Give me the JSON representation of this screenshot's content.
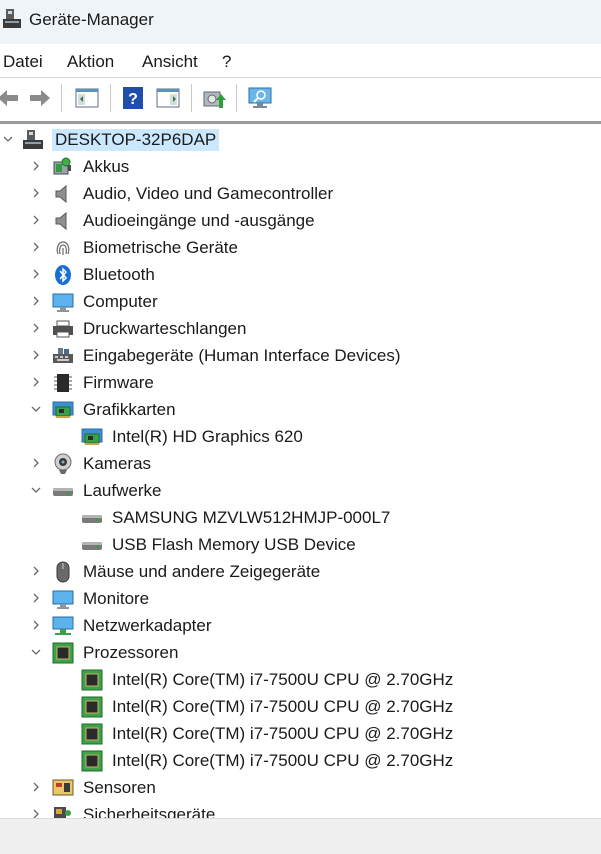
{
  "window": {
    "title": "Geräte-Manager"
  },
  "menu": [
    "Datei",
    "Aktion",
    "Ansicht",
    "?"
  ],
  "toolbar": [
    "back-icon",
    "forward-icon",
    "show-hide-console-tree-icon",
    "help-icon",
    "properties-pane-icon",
    "update-driver-icon",
    "scan-hardware-icon"
  ],
  "tree": {
    "root": "DESKTOP-32P6DAP",
    "nodes": [
      {
        "label": "Akkus",
        "icon": "battery-icon",
        "expanded": false,
        "children": []
      },
      {
        "label": "Audio, Video und Gamecontroller",
        "icon": "speaker-icon",
        "expanded": false,
        "children": []
      },
      {
        "label": "Audioeingänge und -ausgänge",
        "icon": "speaker-icon",
        "expanded": false,
        "children": []
      },
      {
        "label": "Biometrische Geräte",
        "icon": "fingerprint-icon",
        "expanded": false,
        "children": []
      },
      {
        "label": "Bluetooth",
        "icon": "bluetooth-icon",
        "expanded": false,
        "children": []
      },
      {
        "label": "Computer",
        "icon": "monitor-icon",
        "expanded": false,
        "children": []
      },
      {
        "label": "Druckwarteschlangen",
        "icon": "printer-icon",
        "expanded": false,
        "children": []
      },
      {
        "label": "Eingabegeräte (Human Interface Devices)",
        "icon": "hid-icon",
        "expanded": false,
        "children": []
      },
      {
        "label": "Firmware",
        "icon": "chip-icon",
        "expanded": false,
        "children": []
      },
      {
        "label": "Grafikkarten",
        "icon": "display-adapter-icon",
        "expanded": true,
        "children": [
          {
            "label": "Intel(R) HD Graphics 620",
            "icon": "display-adapter-icon"
          }
        ]
      },
      {
        "label": "Kameras",
        "icon": "webcam-icon",
        "expanded": false,
        "children": []
      },
      {
        "label": "Laufwerke",
        "icon": "drive-icon",
        "expanded": true,
        "children": [
          {
            "label": "SAMSUNG MZVLW512HMJP-000L7",
            "icon": "drive-icon"
          },
          {
            "label": "USB Flash Memory USB Device",
            "icon": "drive-icon"
          }
        ]
      },
      {
        "label": "Mäuse und andere Zeigegeräte",
        "icon": "mouse-icon",
        "expanded": false,
        "children": []
      },
      {
        "label": "Monitore",
        "icon": "monitor-icon",
        "expanded": false,
        "children": []
      },
      {
        "label": "Netzwerkadapter",
        "icon": "network-icon",
        "expanded": false,
        "children": []
      },
      {
        "label": "Prozessoren",
        "icon": "cpu-icon",
        "expanded": true,
        "children": [
          {
            "label": "Intel(R) Core(TM) i7-7500U CPU @ 2.70GHz",
            "icon": "cpu-icon"
          },
          {
            "label": "Intel(R) Core(TM) i7-7500U CPU @ 2.70GHz",
            "icon": "cpu-icon"
          },
          {
            "label": "Intel(R) Core(TM) i7-7500U CPU @ 2.70GHz",
            "icon": "cpu-icon"
          },
          {
            "label": "Intel(R) Core(TM) i7-7500U CPU @ 2.70GHz",
            "icon": "cpu-icon"
          }
        ]
      },
      {
        "label": "Sensoren",
        "icon": "sensor-icon",
        "expanded": false,
        "children": []
      },
      {
        "label": "Sicherheitsgeräte",
        "icon": "security-device-icon",
        "expanded": false,
        "children": []
      }
    ]
  },
  "colors": {
    "titlebar": "#eff4f9",
    "selection": "#cce8ff",
    "statusbar": "#f0f0f0"
  }
}
